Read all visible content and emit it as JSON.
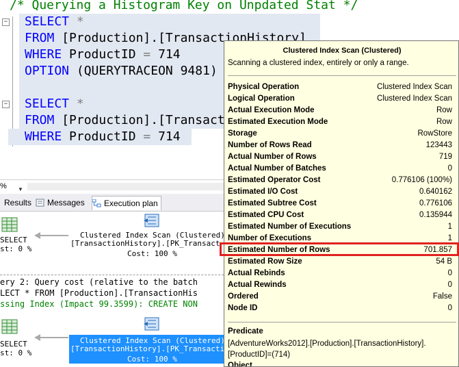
{
  "editor": {
    "comment": "/* Querying a Histogram Key on Unpdated Stat */",
    "q1": {
      "select": "SELECT",
      "star": "*",
      "from": "FROM",
      "table": "[Production].[TransactionHistory]",
      "where": "WHERE",
      "column": "ProductID",
      "eq": "=",
      "value": "714",
      "option": "OPTION",
      "option_arg": "(QUERYTRACEON 9481)"
    },
    "q2": {
      "select": "SELECT",
      "star": "*",
      "from": "FROM",
      "table": "[Production].[Transact",
      "where": "WHERE",
      "column": "ProductID",
      "eq": "=",
      "value": "714"
    }
  },
  "status": {
    "zoom": "%"
  },
  "tabs": [
    {
      "label": "Results",
      "active": false
    },
    {
      "label": "Messages",
      "active": false
    },
    {
      "label": "Execution plan",
      "active": true
    }
  ],
  "plan": {
    "q1": {
      "select_label": "SELECT",
      "select_cost": "st: 0 %",
      "op_name": "Clustered Index Scan (Clustered)",
      "op_object": "[TransactionHistory].[PK_Transact",
      "op_cost": "Cost: 100 %"
    },
    "q2_header": "ery 2: Query cost (relative to the batch",
    "q2_sql": "LECT * FROM [Production].[TransactionHis",
    "q2_missing": "ssing Index (Impact 99.3599): CREATE NON",
    "q2": {
      "select_label": "SELECT",
      "select_cost": "st: 0 %",
      "op_name": "Clustered Index Scan (Clustered)",
      "op_object": "[TransactionHistory].[PK_Transacti",
      "op_cost": "Cost: 100 %"
    }
  },
  "tooltip": {
    "title": "Clustered Index Scan (Clustered)",
    "description": "Scanning a clustered index, entirely or only a range.",
    "rows": [
      {
        "label": "Physical Operation",
        "value": "Clustered Index Scan"
      },
      {
        "label": "Logical Operation",
        "value": "Clustered Index Scan"
      },
      {
        "label": "Actual Execution Mode",
        "value": "Row"
      },
      {
        "label": "Estimated Execution Mode",
        "value": "Row"
      },
      {
        "label": "Storage",
        "value": "RowStore"
      },
      {
        "label": "Number of Rows Read",
        "value": "123443"
      },
      {
        "label": "Actual Number of Rows",
        "value": "719"
      },
      {
        "label": "Actual Number of Batches",
        "value": "0"
      },
      {
        "label": "Estimated Operator Cost",
        "value": "0.776106 (100%)"
      },
      {
        "label": "Estimated I/O Cost",
        "value": "0.640162"
      },
      {
        "label": "Estimated Subtree Cost",
        "value": "0.776106"
      },
      {
        "label": "Estimated CPU Cost",
        "value": "0.135944"
      },
      {
        "label": "Estimated Number of Executions",
        "value": "1"
      },
      {
        "label": "Number of Executions",
        "value": "1"
      },
      {
        "label": "Estimated Number of Rows",
        "value": "701.857"
      },
      {
        "label": "Estimated Row Size",
        "value": "54 B"
      },
      {
        "label": "Actual Rebinds",
        "value": "0"
      },
      {
        "label": "Actual Rewinds",
        "value": "0"
      },
      {
        "label": "Ordered",
        "value": "False"
      },
      {
        "label": "Node ID",
        "value": "0"
      }
    ],
    "predicate_label": "Predicate",
    "predicate_text": "[AdventureWorks2012].[Production].[TransactionHistory].[ProductID]=(714)",
    "object_label": "Object"
  },
  "colors": {
    "keyword": "#0000ff",
    "comment": "#008000",
    "highlight": "#e02020",
    "tooltip_bg": "#ffffe1",
    "selected_op": "#1e90ff"
  }
}
